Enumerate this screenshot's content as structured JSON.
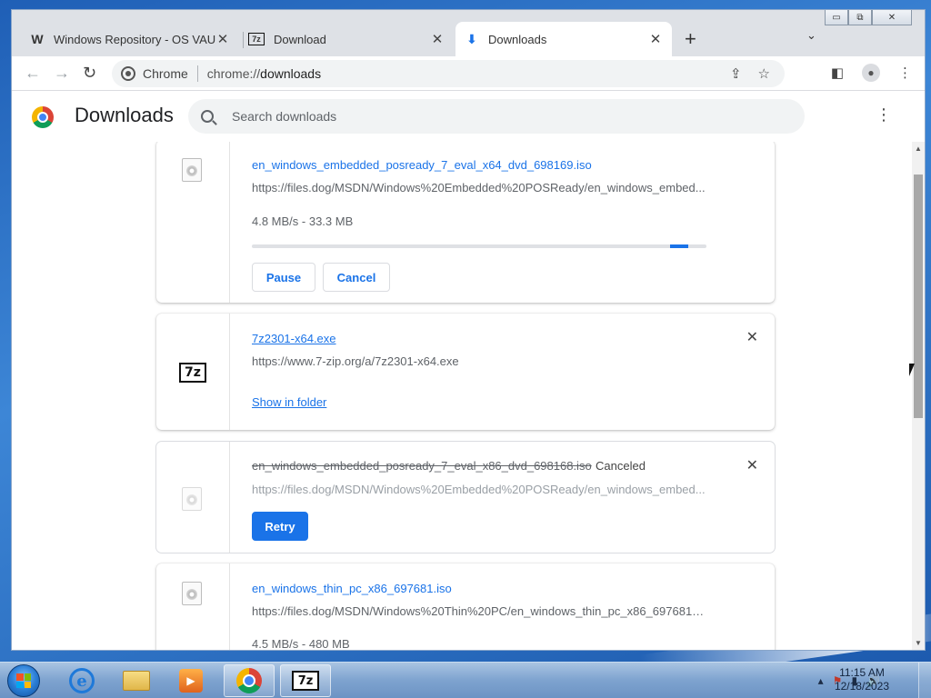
{
  "browser": {
    "tabs": [
      {
        "title": "Windows Repository - OS VAULT",
        "icon": "wordpress-w-icon",
        "glyph": "W",
        "active": false
      },
      {
        "title": "Download",
        "icon": "7zip-icon",
        "glyph": "7z",
        "active": false
      },
      {
        "title": "Downloads",
        "icon": "download-arrow-icon",
        "glyph": "⬇",
        "active": true
      }
    ],
    "new_tab_glyph": "+",
    "tab_search_glyph": "⌄",
    "close_glyph": "✕",
    "window_controls": {
      "minimize": "▭",
      "restore": "⧉",
      "close": "✕"
    },
    "toolbar": {
      "back": "←",
      "forward": "→",
      "reload": "↻",
      "site_label": "Chrome",
      "url_scheme": "chrome://",
      "url_path": "downloads",
      "share": "⇪",
      "bookmark": "☆",
      "sidepanel": "◧",
      "profile": "●",
      "menu": "⋮"
    }
  },
  "downloads_page": {
    "title": "Downloads",
    "search_placeholder": "Search downloads",
    "menu_glyph": "⋮",
    "items": [
      {
        "name": "en_windows_embedded_posready_7_eval_x64_dvd_698169.iso",
        "url": "https://files.dog/MSDN/Windows%20Embedded%20POSReady/en_windows_embed...",
        "status": "4.8 MB/s - 33.3 MB",
        "progress": 0.96,
        "buttons": {
          "pause": "Pause",
          "cancel": "Cancel"
        }
      },
      {
        "name": "7z2301-x64.exe",
        "url": "https://www.7-zip.org/a/7z2301-x64.exe",
        "action_link": "Show in folder",
        "icon_glyph": "7z"
      },
      {
        "name": "en_windows_embedded_posready_7_eval_x86_dvd_698168.iso",
        "state_label": "Canceled",
        "url": "https://files.dog/MSDN/Windows%20Embedded%20POSReady/en_windows_embed...",
        "retry": "Retry"
      },
      {
        "name": "en_windows_thin_pc_x86_697681.iso",
        "url": "https://files.dog/MSDN/Windows%20Thin%20PC/en_windows_thin_pc_x86_697681.i...",
        "status": "4.5 MB/s - 480 MB"
      }
    ]
  },
  "taskbar": {
    "items": [
      {
        "name": "internet-explorer",
        "glyph": "e"
      },
      {
        "name": "windows-explorer"
      },
      {
        "name": "media-player",
        "glyph": "▶"
      },
      {
        "name": "chrome"
      },
      {
        "name": "7zip",
        "glyph": "7z"
      }
    ],
    "tray": {
      "arrow": "▴",
      "flag": "⚑",
      "power": "▮",
      "volume": "🔊"
    },
    "clock": {
      "time": "11:15 AM",
      "date": "12/18/2023"
    }
  },
  "colors": {
    "accent": "#1a73e8",
    "tabstrip": "#dee1e6",
    "taskbar": "#7ea3cf"
  }
}
